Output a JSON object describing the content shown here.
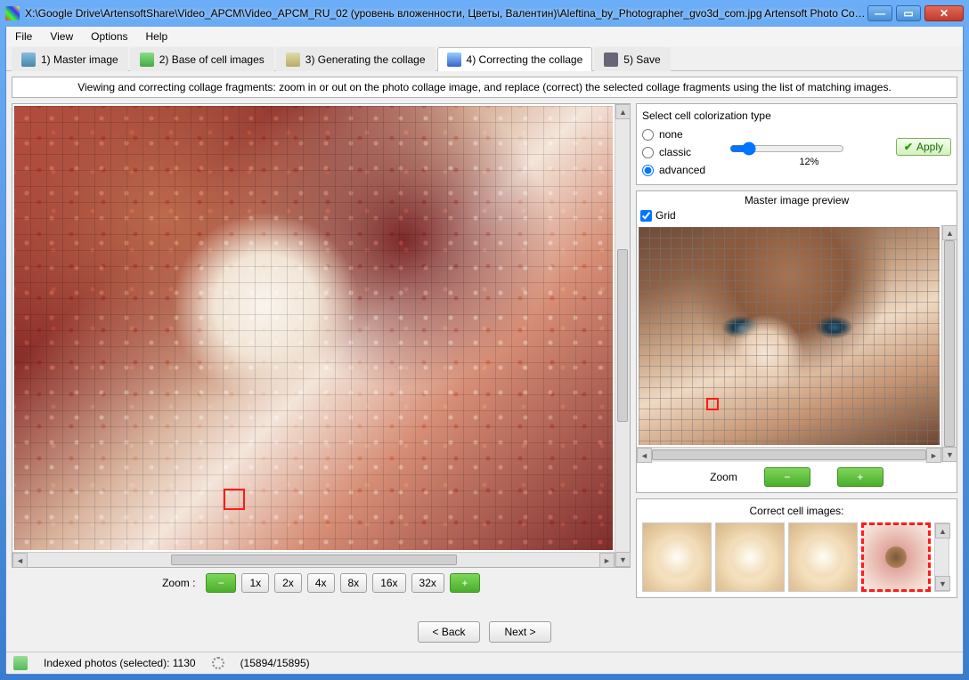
{
  "titlebar": {
    "path": "X:\\Google Drive\\ArtensoftShare\\Video_APCM\\Video_APCM_RU_02 (уровень вложенности, Цветы, Валентин)\\Aleftina_by_Photographer_gvo3d_com.jpg Artensoft Photo Collag..."
  },
  "menu": {
    "file": "File",
    "view": "View",
    "options": "Options",
    "help": "Help"
  },
  "tabs": {
    "t1": "1) Master image",
    "t2": "2) Base of cell images",
    "t3": "3) Generating the collage",
    "t4": "4) Correcting the collage",
    "t5": "5) Save"
  },
  "infobar": "Viewing and correcting collage fragments: zoom in or out on the photo collage image, and replace (correct) the selected collage fragments using the list of matching images.",
  "left_zoom": {
    "label": "Zoom   :",
    "x1": "1x",
    "x2": "2x",
    "x4": "4x",
    "x8": "8x",
    "x16": "16x",
    "x32": "32x"
  },
  "colorize": {
    "title": "Select cell colorization type",
    "none": "none",
    "classic": "classic",
    "advanced": "advanced",
    "percent": "12%",
    "apply": "Apply"
  },
  "preview": {
    "title": "Master image preview",
    "grid": "Grid",
    "zoom": "Zoom"
  },
  "cells": {
    "title": "Correct cell images:"
  },
  "nav": {
    "back": "< Back",
    "next": "Next >"
  },
  "status": {
    "indexed": "Indexed photos (selected): 1130",
    "progress": "(15894/15895)"
  }
}
